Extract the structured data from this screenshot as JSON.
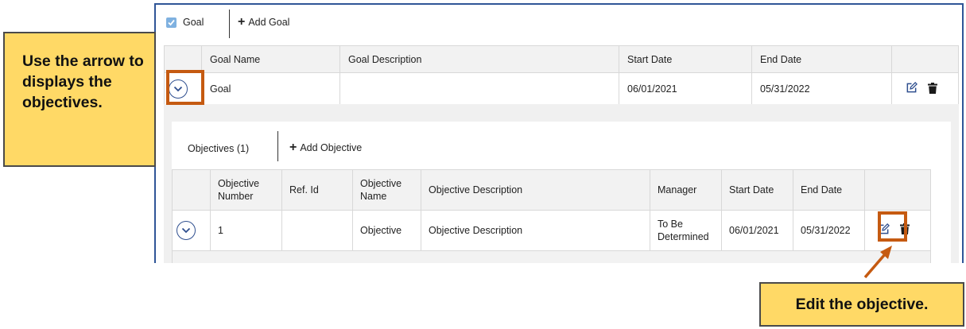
{
  "goal_toolbar": {
    "tab_label": "Goal",
    "add_label": "Add Goal"
  },
  "goal_table": {
    "headers": [
      "",
      "Goal Name",
      "Goal Description",
      "Start Date",
      "End Date",
      ""
    ],
    "row": {
      "name": "Goal",
      "description": "",
      "start": "06/01/2021",
      "end": "05/31/2022"
    }
  },
  "objectives": {
    "tab_label": "Objectives (1)",
    "add_label": "Add Objective",
    "headers": [
      "",
      "Objective Number",
      "Ref. Id",
      "Objective Name",
      "Objective Description",
      "Manager",
      "Start Date",
      "End Date",
      ""
    ],
    "row": {
      "number": "1",
      "ref_id": "",
      "name": "Objective",
      "description": "Objective Description",
      "manager": "To Be Determined",
      "start": "06/01/2021",
      "end": "05/31/2022"
    }
  },
  "callouts": {
    "left": "Use the arrow to displays the objectives.",
    "right": "Edit the objective."
  },
  "colors": {
    "frame": "#2f5597",
    "highlight": "#c55a11",
    "callout": "#ffd966",
    "icon": "#2f4f8f"
  },
  "icons": [
    "check-icon",
    "plus-icon",
    "chevron-down-icon",
    "edit-icon",
    "trash-icon"
  ]
}
